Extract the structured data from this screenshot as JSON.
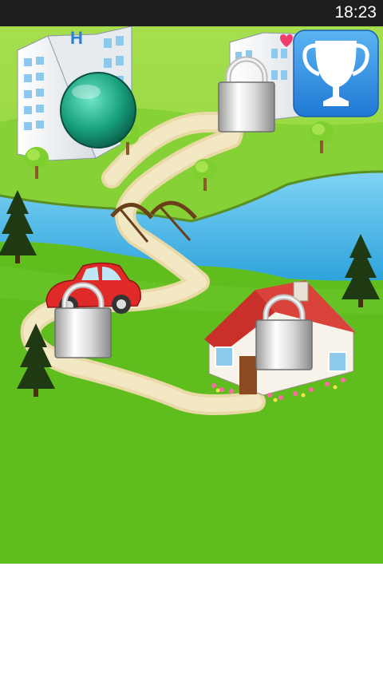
{
  "status_bar": {
    "time": "18:23"
  },
  "game": {
    "levels": [
      {
        "name": "hospital",
        "state": "current"
      },
      {
        "name": "school",
        "state": "locked"
      },
      {
        "name": "car",
        "state": "locked"
      },
      {
        "name": "house",
        "state": "locked"
      }
    ]
  },
  "colors": {
    "grass_bright": "#5fbe1e",
    "grass_back": "#8fd43a",
    "water": "#4ab7e6",
    "path": "#eadcab",
    "trophy_blue": "#2f8fe6",
    "current_marker": "#1fa886",
    "car_red": "#e02a28",
    "roof_red": "#c9302a"
  },
  "icons": {
    "trophy": "trophy-icon",
    "lock": "padlock-icon",
    "marker": "green-ball-marker"
  }
}
